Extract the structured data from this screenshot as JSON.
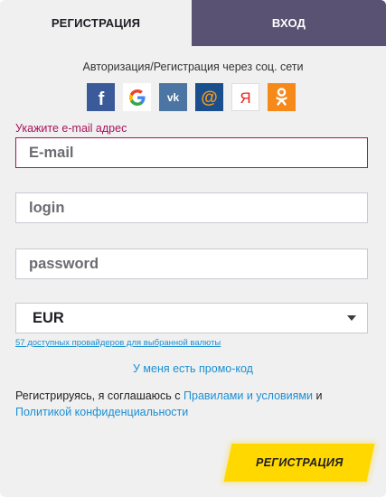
{
  "tabs": {
    "register": "РЕГИСТРАЦИЯ",
    "login": "ВХОД"
  },
  "social": {
    "title": "Авторизация/Регистрация через соц. сети",
    "providers": [
      {
        "icon": "facebook-icon",
        "letter": "f"
      },
      {
        "icon": "google-icon",
        "letter": "G"
      },
      {
        "icon": "vk-icon",
        "letter": "vk"
      },
      {
        "icon": "mailru-icon",
        "letter": "@"
      },
      {
        "icon": "yandex-icon",
        "letter": "Я"
      },
      {
        "icon": "odnoklassniki-icon",
        "letter": "ok"
      }
    ]
  },
  "form": {
    "email_label": "Укажите e-mail адрес",
    "email_placeholder": "E-mail",
    "login_placeholder": "login",
    "password_placeholder": "password",
    "currency": "EUR",
    "providers_link": "57 доступных провайдеров для выбранной валюты",
    "promo_link": "У меня есть промо-код",
    "agree_prefix": "Регистрируясь, я соглашаюсь с",
    "terms_link": "Правилами и условиями",
    "and": "и",
    "privacy_link": "Политикой конфиденциальности",
    "submit": "РЕГИСТРАЦИЯ"
  },
  "colors": {
    "active_tab_bg": "#f0f0f0",
    "inactive_tab_bg": "#5a5273",
    "error_accent": "#a8135a",
    "link": "#1b8fd3",
    "submit_bg": "#ffd800"
  }
}
